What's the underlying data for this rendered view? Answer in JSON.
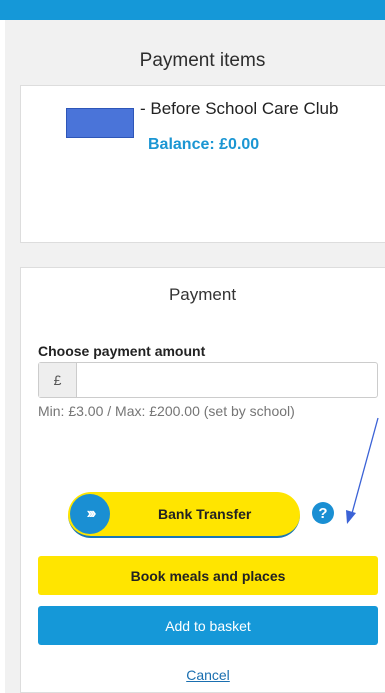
{
  "payment_items": {
    "title": "Payment items",
    "item": {
      "name": "- Before School Care Club",
      "balance": "Balance: £0.00"
    }
  },
  "payment": {
    "title": "Payment",
    "amount_label": "Choose payment amount",
    "currency_symbol": "£",
    "amount_value": "",
    "amount_hint": "Min: £3.00 / Max: £200.00 (set by school)",
    "bank_transfer": {
      "label": "Bank Transfer",
      "icon": "chevrons-right-icon",
      "icon_glyph": "›››"
    },
    "help_icon": {
      "icon": "question-circle-icon",
      "glyph": "?"
    },
    "book_meals_label": "Book meals and places",
    "add_to_basket_label": "Add to basket",
    "cancel_label": "Cancel"
  },
  "colors": {
    "brand_blue": "#1598d8",
    "accent_yellow": "#ffe500",
    "balance_blue": "#1b96d3",
    "annotation_blue": "#3b62d6"
  }
}
